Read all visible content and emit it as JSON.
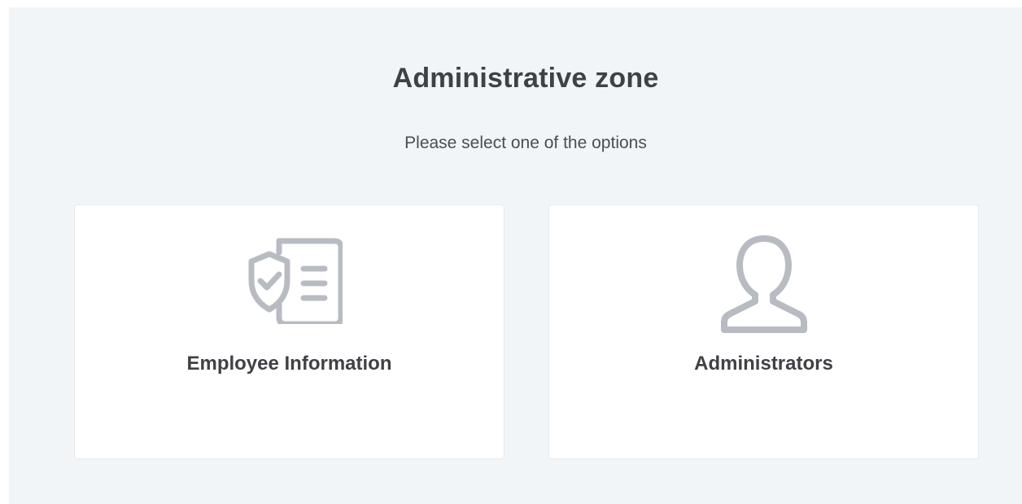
{
  "header": {
    "title": "Administrative zone",
    "subtitle": "Please select one of the options"
  },
  "options": [
    {
      "label": "Employee Information",
      "icon": "shield-document-icon"
    },
    {
      "label": "Administrators",
      "icon": "user-icon"
    }
  ],
  "colors": {
    "background": "#f2f5f8",
    "card": "#ffffff",
    "icon": "#b8bcc2",
    "text": "#3f4145"
  }
}
